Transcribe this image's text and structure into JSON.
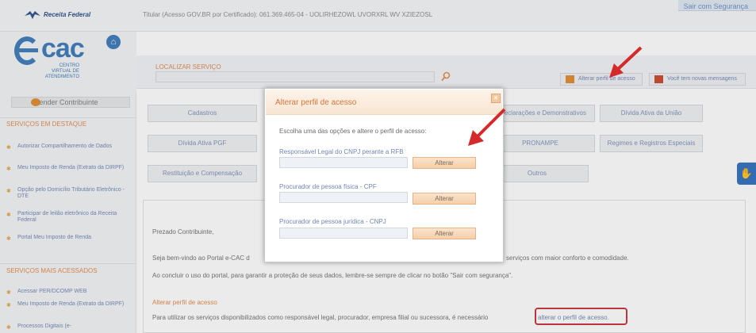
{
  "header": {
    "brand": "Receita Federal",
    "titular": "Titular (Acesso GOV.BR por Certificado): 061.369.465-04 - UOLIRHEZOWL UVORXRL WV XZIEZOSL",
    "logout_label": "Sair com Segurança"
  },
  "ecac": {
    "logo_text": "cac",
    "subtitle": "CENTRO VIRTUAL DE ATENDIMENTO"
  },
  "sidebar": {
    "atender_label": "Atender Contribuinte",
    "destaque_title": "SERVIÇOS EM DESTAQUE",
    "destaque_items": [
      {
        "label": "Autorizar Compartilhamento de Dados"
      },
      {
        "label": "Meu Imposto de Renda (Extrato da DIRPF)"
      },
      {
        "label": "Opção pelo Domicílio Tributário Eletrônico - DTE"
      },
      {
        "label": "Participar de leilão eletrônico da Receita Federal"
      },
      {
        "label": "Portal Meu Imposto de Renda"
      }
    ],
    "acessados_title": "SERVIÇOS MAIS ACESSADOS",
    "acessados_items": [
      {
        "label": "Acessar PER/DCOMP WEB"
      },
      {
        "label": "Meu Imposto de Renda (Extrato da DIRPF)"
      },
      {
        "label": "Processos Digitais (e-"
      }
    ]
  },
  "search": {
    "label": "LOCALIZAR SERVIÇO",
    "value": ""
  },
  "toolbar": {
    "alterar_perfil_label": "Alterar perfil de acesso",
    "mensagens_label": "Você tem novas mensagens"
  },
  "services": {
    "row1": [
      "Cadastros",
      "Declarações e Demonstrativos",
      "Dívida Ativa da União"
    ],
    "row2": [
      "Dívida Ativa PGF",
      "PRONAMPE",
      "Regimes e Registros Especiais"
    ],
    "row3": [
      "Restituição e Compensação",
      "Outros"
    ]
  },
  "content": {
    "greeting": "Prezado Contribuinte,",
    "welcome_start": "Seja bem-vindo ao Portal e-CAC d",
    "welcome_end": "serviços com maior conforto e comodidade.",
    "logout_note": "Ao concluir o uso do portal, para garantir a proteção de seus dados, lembre-se sempre de clicar no botão \"Sair com segurança\".",
    "section_title": "Alterar perfil de acesso",
    "profile_text": "Para utilizar os serviços disponibilizados como responsável legal, procurador, empresa filial ou sucessora, é necessário",
    "profile_link": "alterar o perfil de acesso."
  },
  "modal": {
    "title": "Alterar perfil de acesso",
    "instructions": "Escolha uma das opções e altere o perfil de acesso:",
    "options": [
      {
        "label": "Responsável Legal do CNPJ perante a RFB",
        "value": "",
        "button": "Alterar"
      },
      {
        "label": "Procurador de pessoa física - CPF",
        "value": "",
        "button": "Alterar"
      },
      {
        "label": "Procurador de pessoa jurídica - CNPJ",
        "value": "",
        "button": "Alterar"
      }
    ],
    "close_symbol": "×"
  },
  "colors": {
    "brand_blue": "#3a79b8",
    "accent_orange": "#e2894c",
    "highlight_red": "#c6303a"
  }
}
